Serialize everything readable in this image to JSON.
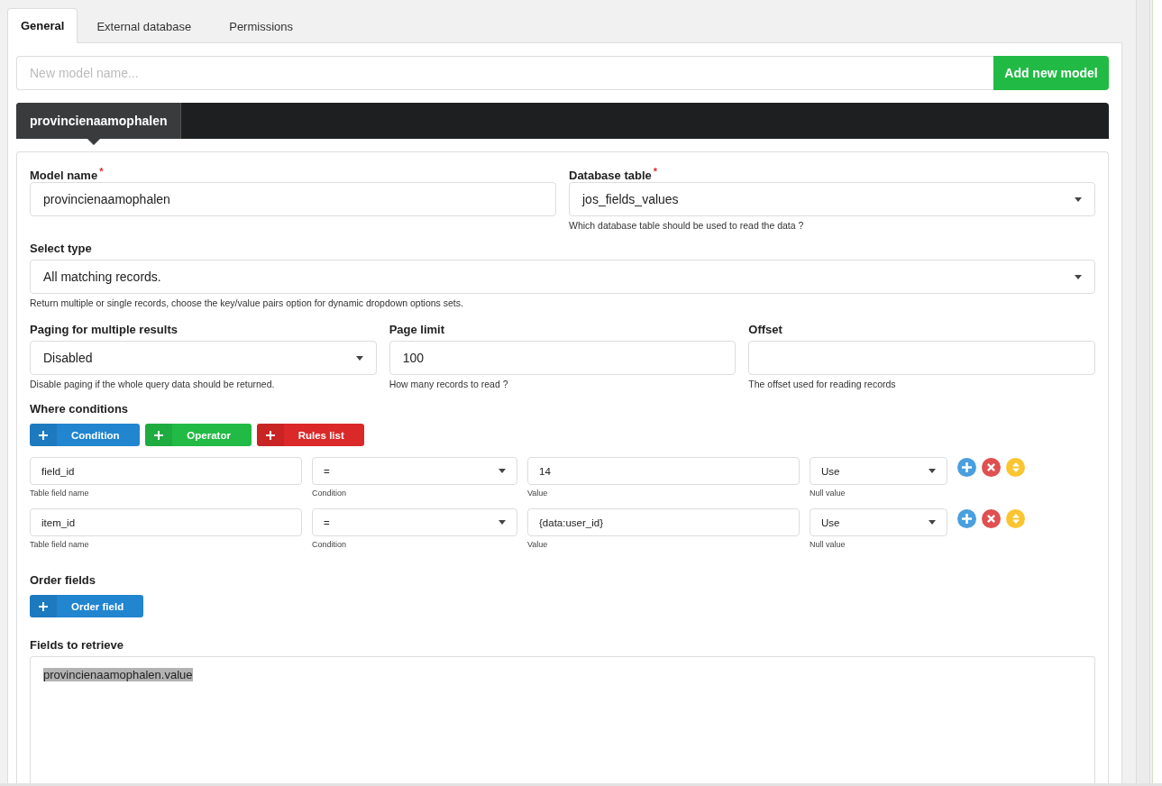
{
  "tabs": [
    {
      "label": "General",
      "selected": true
    },
    {
      "label": "External database",
      "selected": false
    },
    {
      "label": "Permissions",
      "selected": false
    }
  ],
  "new_model": {
    "placeholder": "New model name...",
    "button": "Add new model"
  },
  "model_tabs": [
    {
      "label": "provincienaamophalen",
      "selected": true
    }
  ],
  "model_name": {
    "label": "Model name",
    "required": true,
    "required_mark": "*",
    "value": "provincienaamophalen"
  },
  "database_table": {
    "label": "Database table",
    "required": true,
    "required_mark": "*",
    "value": "jos_fields_values",
    "help": "Which database table should be used to read the data ?"
  },
  "select_type": {
    "label": "Select type",
    "value": "All matching records.",
    "help": "Return multiple or single records, choose the key/value pairs option for dynamic dropdown options sets."
  },
  "paging": [
    {
      "kind": "select",
      "label": "Paging for multiple results",
      "value": "Disabled",
      "help": "Disable paging if the whole query data should be returned."
    },
    {
      "kind": "input",
      "label": "Page limit",
      "value": "100",
      "help": "How many records to read ?"
    },
    {
      "kind": "input",
      "label": "Offset",
      "help": "The offset used for reading records"
    }
  ],
  "where_conditions": {
    "label": "Where conditions",
    "buttons": [
      {
        "label": "Condition",
        "color": "#2185d0"
      },
      {
        "label": "Operator",
        "color": "#21ba45"
      },
      {
        "label": "Rules list",
        "color": "#db2828"
      }
    ],
    "rows": [
      {
        "field": "field_id",
        "field_help": "Table field name",
        "condition": "=",
        "condition_help": "Condition",
        "value": "14",
        "value_help": "Value",
        "null_value": "Use",
        "null_help": "Null value"
      },
      {
        "field": "item_id",
        "field_help": "Table field name",
        "condition": "=",
        "condition_help": "Condition",
        "value": "{data:user_id}",
        "value_help": "Value",
        "null_value": "Use",
        "null_help": "Null value"
      }
    ]
  },
  "order_fields": {
    "label": "Order fields",
    "buttons": [
      {
        "label": "Order field",
        "color": "#2185d0"
      }
    ]
  },
  "fields_to_retrieve": {
    "label": "Fields to retrieve",
    "value": "provincienaamophalen.value",
    "text_selected": true
  }
}
